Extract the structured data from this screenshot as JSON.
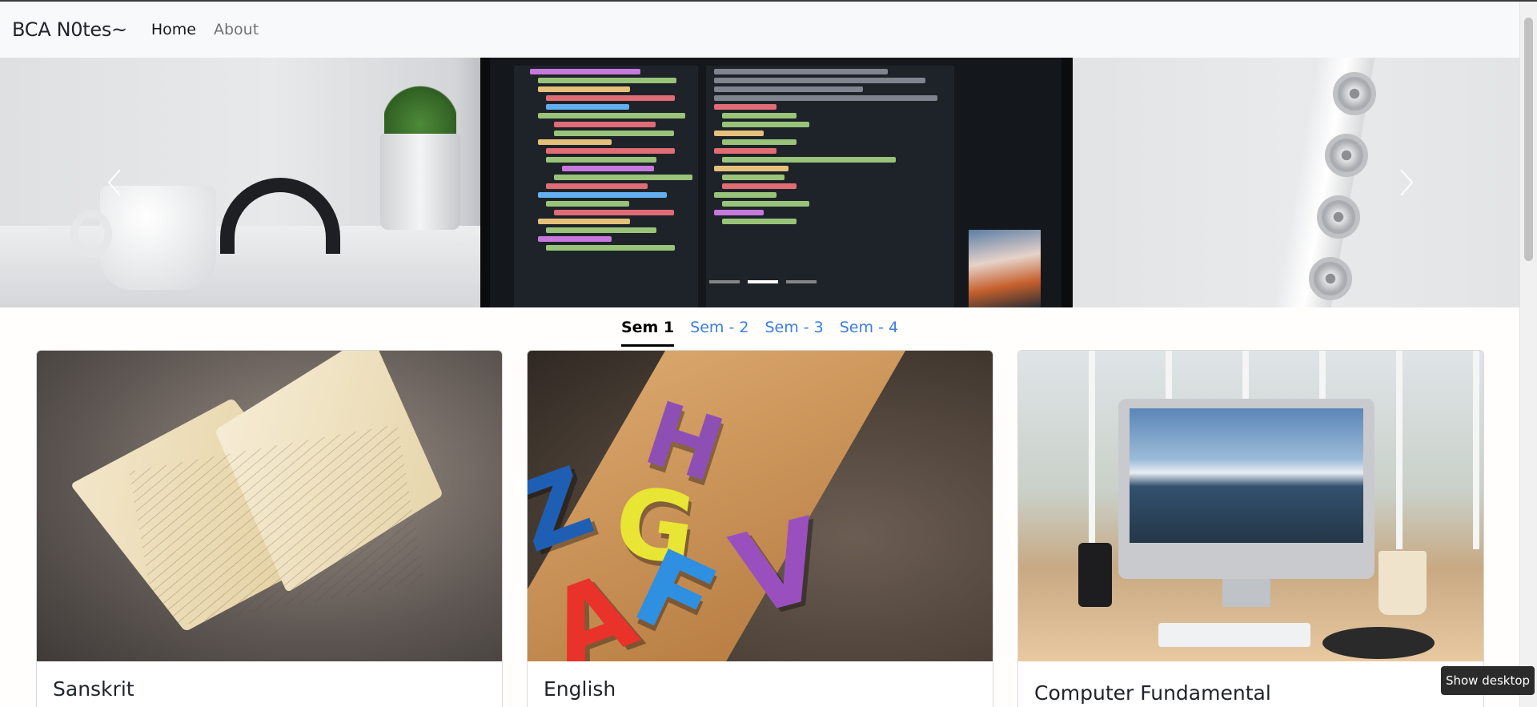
{
  "navbar": {
    "brand": "BCA N0tes~",
    "links": [
      {
        "label": "Home",
        "active": true
      },
      {
        "label": "About",
        "active": false
      }
    ]
  },
  "carousel": {
    "prev_icon": "chevron-left-icon",
    "next_icon": "chevron-right-icon",
    "slide_count": 3,
    "active_index": 1
  },
  "semester_tabs": [
    {
      "label": "Sem 1",
      "active": true
    },
    {
      "label": "Sem - 2",
      "active": false
    },
    {
      "label": "Sem - 3",
      "active": false
    },
    {
      "label": "Sem - 4",
      "active": false
    }
  ],
  "cards": [
    {
      "title": "Sanskrit"
    },
    {
      "title": "English"
    },
    {
      "title": "Computer Fundamental"
    }
  ],
  "tooltip": {
    "text": "Show desktop"
  },
  "colors": {
    "navbar_bg": "#f8f9fa",
    "tab_link": "#3b7de0",
    "tab_active": "#000000"
  }
}
